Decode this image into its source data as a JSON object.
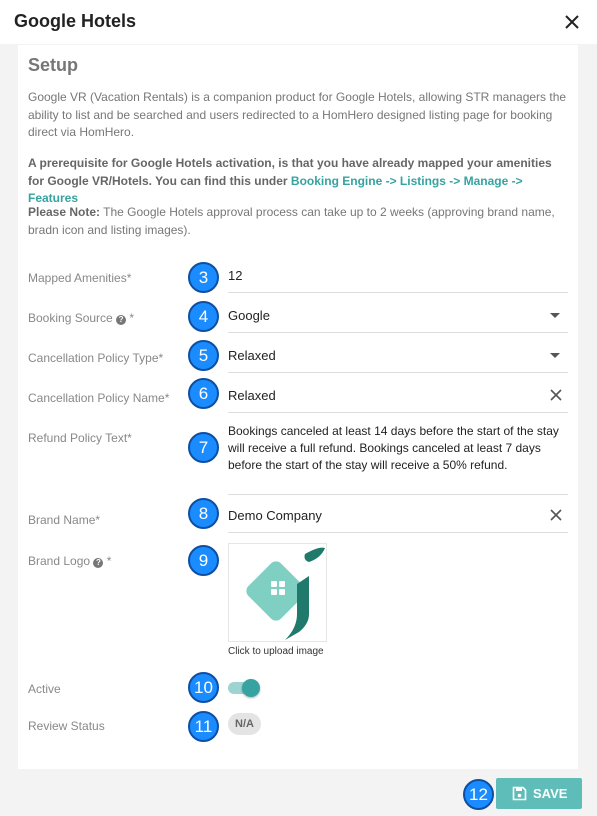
{
  "dialog": {
    "title": "Google Hotels"
  },
  "setup": {
    "title": "Setup",
    "intro": "Google VR (Vacation Rentals) is a companion product for Google Hotels, allowing STR managers the ability to list and be searched and users redirected to a HomHero designed listing page for booking direct via HomHero.",
    "prereq_text": "A prerequisite for Google Hotels activation, is that you have already mapped your amenities for Google VR/Hotels. You can find this under",
    "prereq_link": "Booking Engine -> Listings -> Manage -> Features",
    "note_label": "Please Note:",
    "note_text": "The Google Hotels approval process can take up to 2 weeks (approving brand name, bradn icon and listing images)."
  },
  "fields": {
    "mapped_amenities": {
      "label": "Mapped Amenities*",
      "value": "12"
    },
    "booking_source": {
      "label": "Booking Source",
      "suffix": "*",
      "value": "Google"
    },
    "cancellation_policy_type": {
      "label": "Cancellation Policy Type*",
      "value": "Relaxed"
    },
    "cancellation_policy_name": {
      "label": "Cancellation Policy Name*",
      "value": "Relaxed"
    },
    "refund_policy_text": {
      "label": "Refund Policy Text*",
      "value": "Bookings canceled at least 14 days before the start of the stay will receive a full refund. Bookings canceled at least 7 days before the start of the stay will receive a 50% refund."
    },
    "brand_name": {
      "label": "Brand Name*",
      "value": "Demo Company"
    },
    "brand_logo": {
      "label": "Brand Logo",
      "suffix": "*",
      "upload_hint": "Click to upload image"
    },
    "active": {
      "label": "Active",
      "on": true
    },
    "review_status": {
      "label": "Review Status",
      "value": "N/A"
    }
  },
  "badges": [
    "3",
    "4",
    "5",
    "6",
    "7",
    "8",
    "9",
    "10",
    "11",
    "12"
  ],
  "actions": {
    "save_label": "SAVE"
  },
  "icons": {
    "close": "close-icon",
    "help": "question-circle-icon",
    "dropdown": "chevron-down-icon",
    "clear": "clear-icon",
    "save": "floppy-disk-icon"
  },
  "colors": {
    "accent": "#36a3a0",
    "save_button": "#5fbdb9",
    "badge": "#1a8cff",
    "logo_house": "#7fcfc3",
    "logo_dark": "#1f7a6b"
  }
}
